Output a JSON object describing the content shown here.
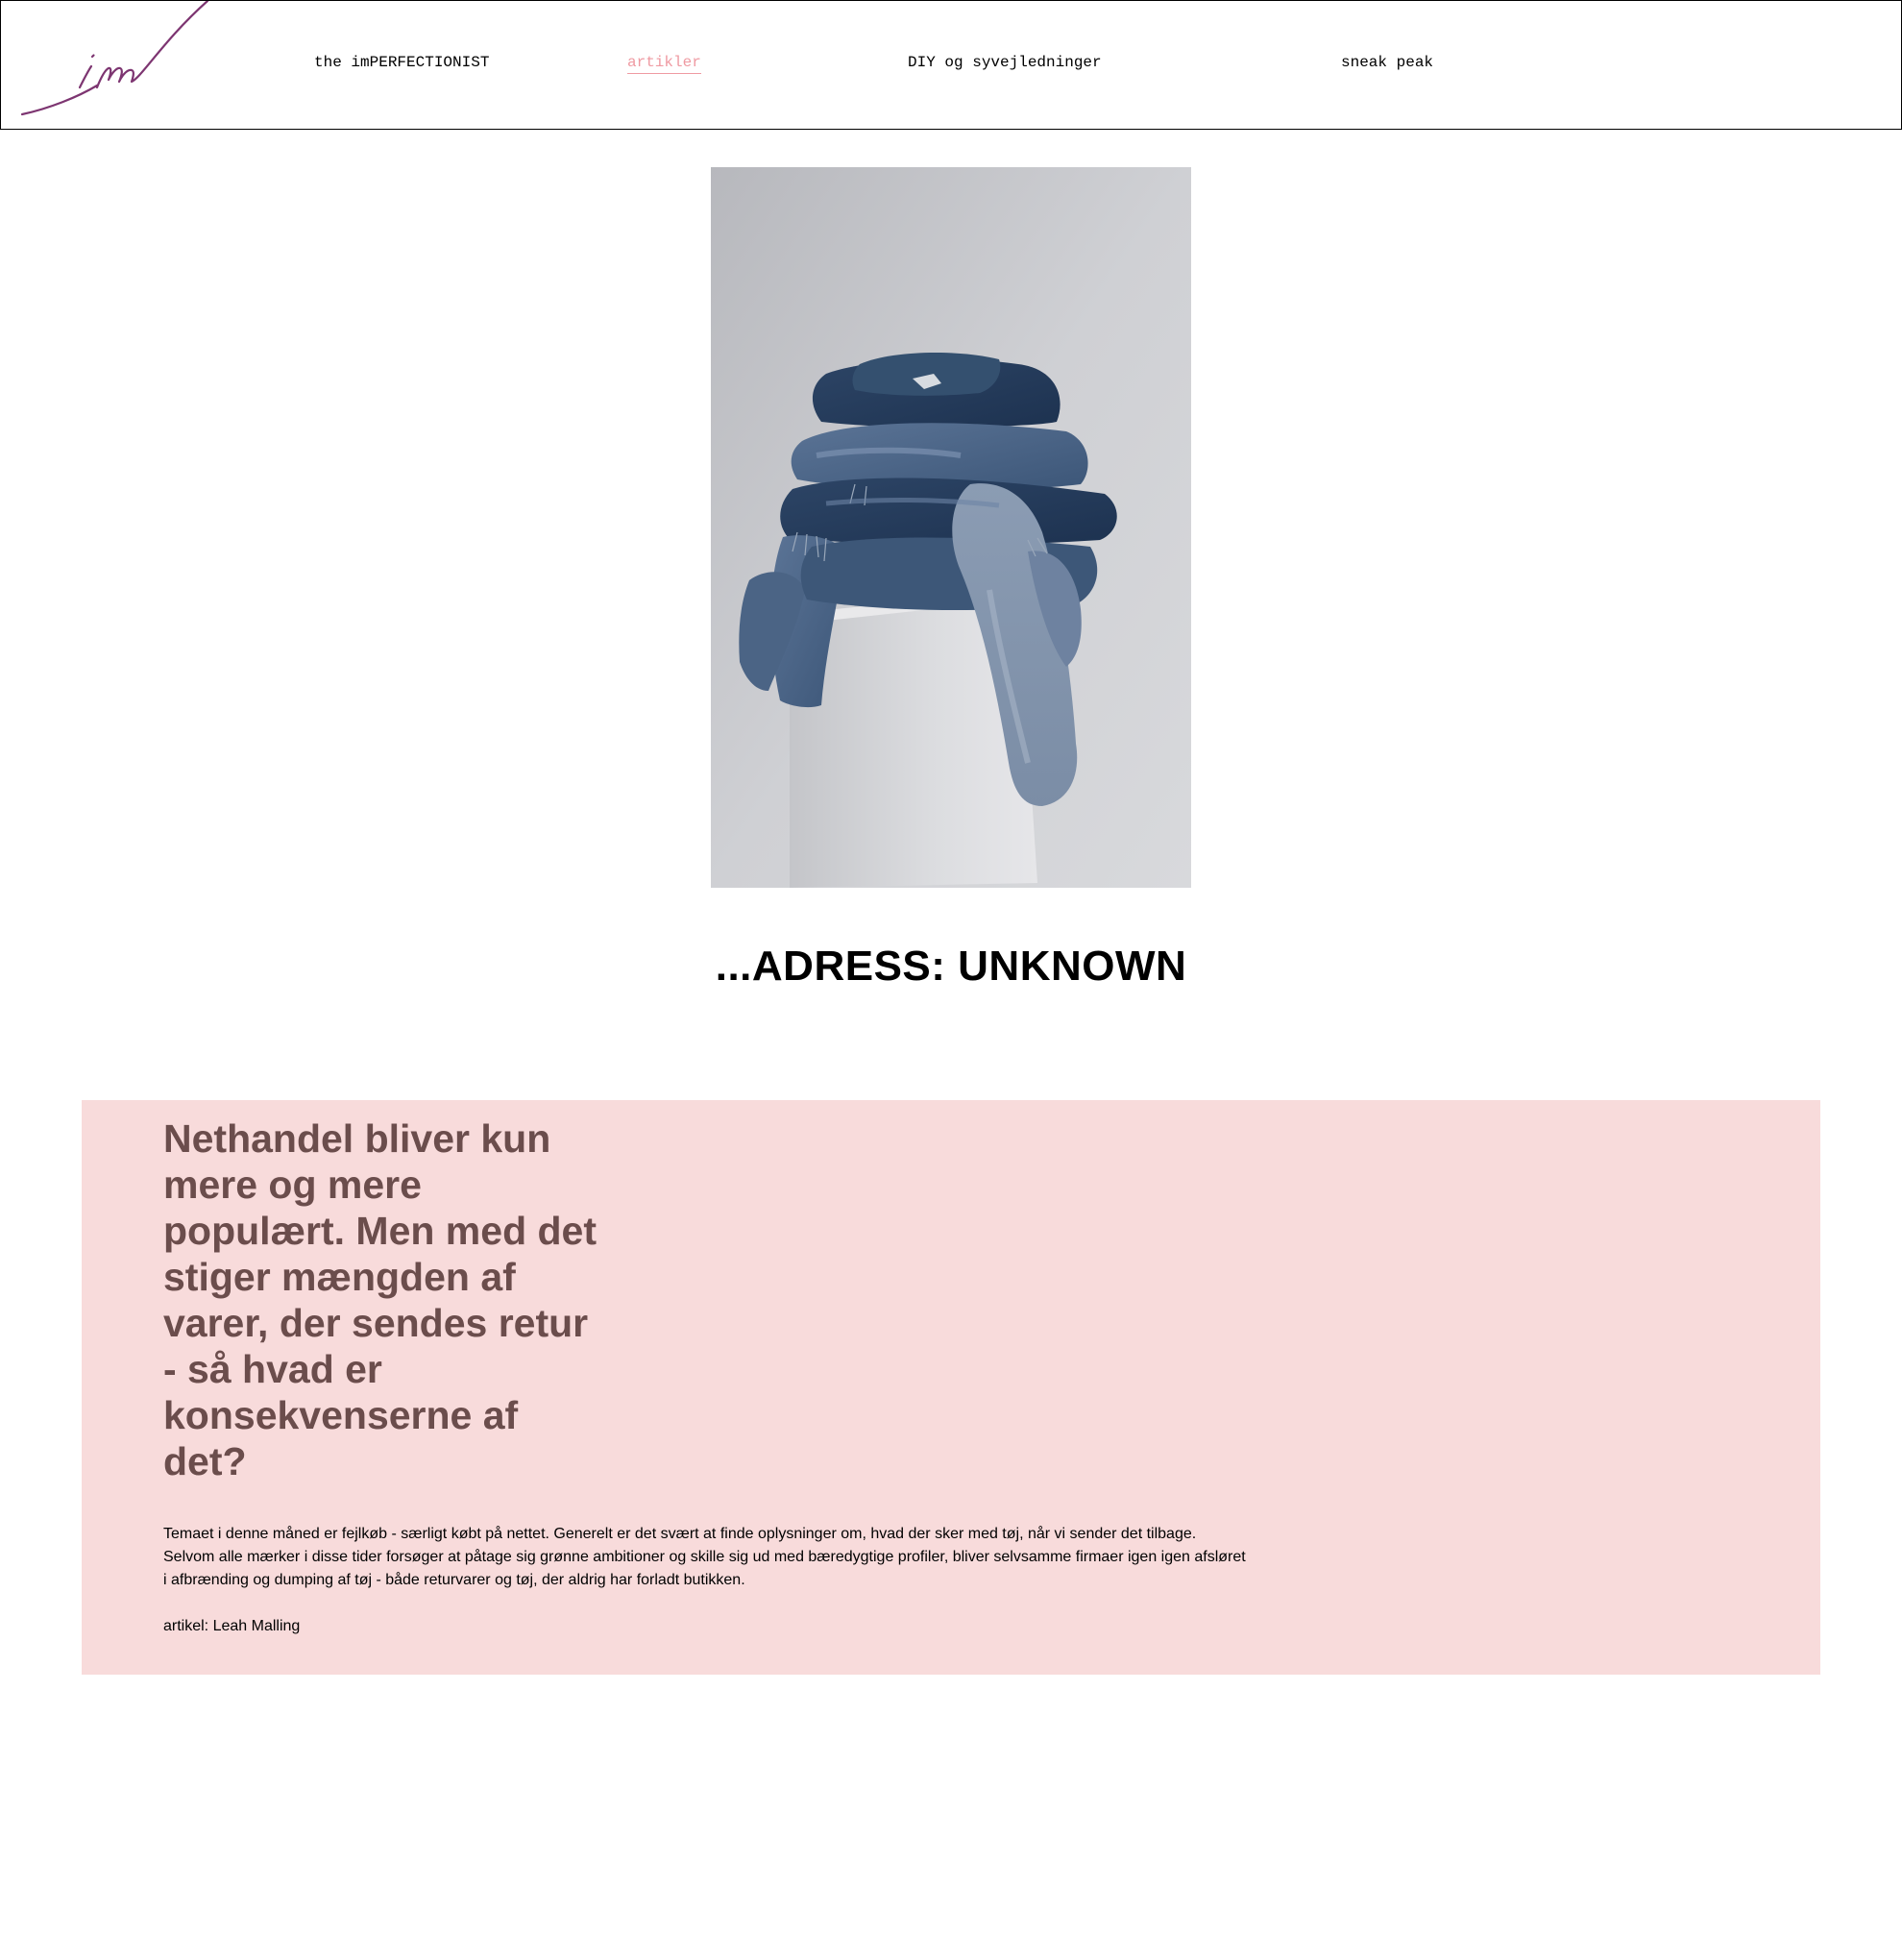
{
  "header": {
    "logo_text": "im",
    "logo_color": "#7d3571",
    "nav": [
      {
        "label": "the imPERFECTIONIST",
        "active": false
      },
      {
        "label": "artikler",
        "active": true
      },
      {
        "label": "DIY og syvejledninger",
        "active": false
      },
      {
        "label": "sneak peak",
        "active": false
      }
    ],
    "active_color": "#ef9aa2"
  },
  "hero": {
    "subject": "pile of jeans on white pedestal",
    "icon": "photo-jeans"
  },
  "article": {
    "title": "...ADRESS: UNKNOWN",
    "lede": "Nethandel bliver kun mere og mere populært. Men med det stiger mængden af varer, der sendes retur - så hvad er konsekvenserne af det?",
    "body": "Temaet i denne måned er fejlkøb - særligt købt på nettet. Generelt er det svært at finde oplysninger om, hvad der sker med tøj, når vi sender det tilbage. Selvom alle mærker i disse tider forsøger at påtage sig grønne ambitioner og skille sig ud med bæredygtige profiler, bliver selvsamme firmaer igen igen afsløret i afbrænding og dumping af tøj - både returvarer og tøj, der aldrig har forladt butikken.",
    "byline": "artikel: Leah Malling"
  },
  "colors": {
    "panel_background": "#f8dbdb",
    "lede_color": "#6b4d4c"
  }
}
